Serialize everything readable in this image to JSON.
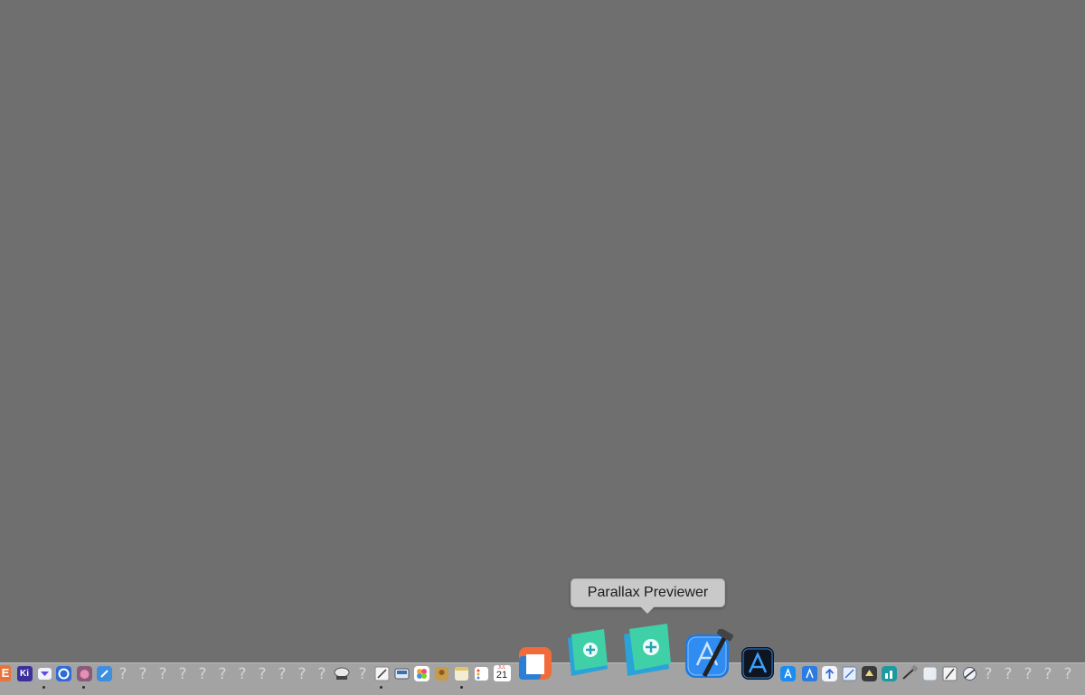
{
  "tooltip": {
    "label": "Parallax Previewer"
  },
  "dock": {
    "unknown_glyph": "?",
    "calendar": {
      "month": "JUL",
      "day": "21"
    },
    "small_icons": {
      "e_app": "E",
      "kindle_app": "Ki"
    }
  },
  "colors": {
    "desktop": "#6f6f6f",
    "dock": "#a3a3a3",
    "tooltip_bg": "#c9c9c9"
  }
}
